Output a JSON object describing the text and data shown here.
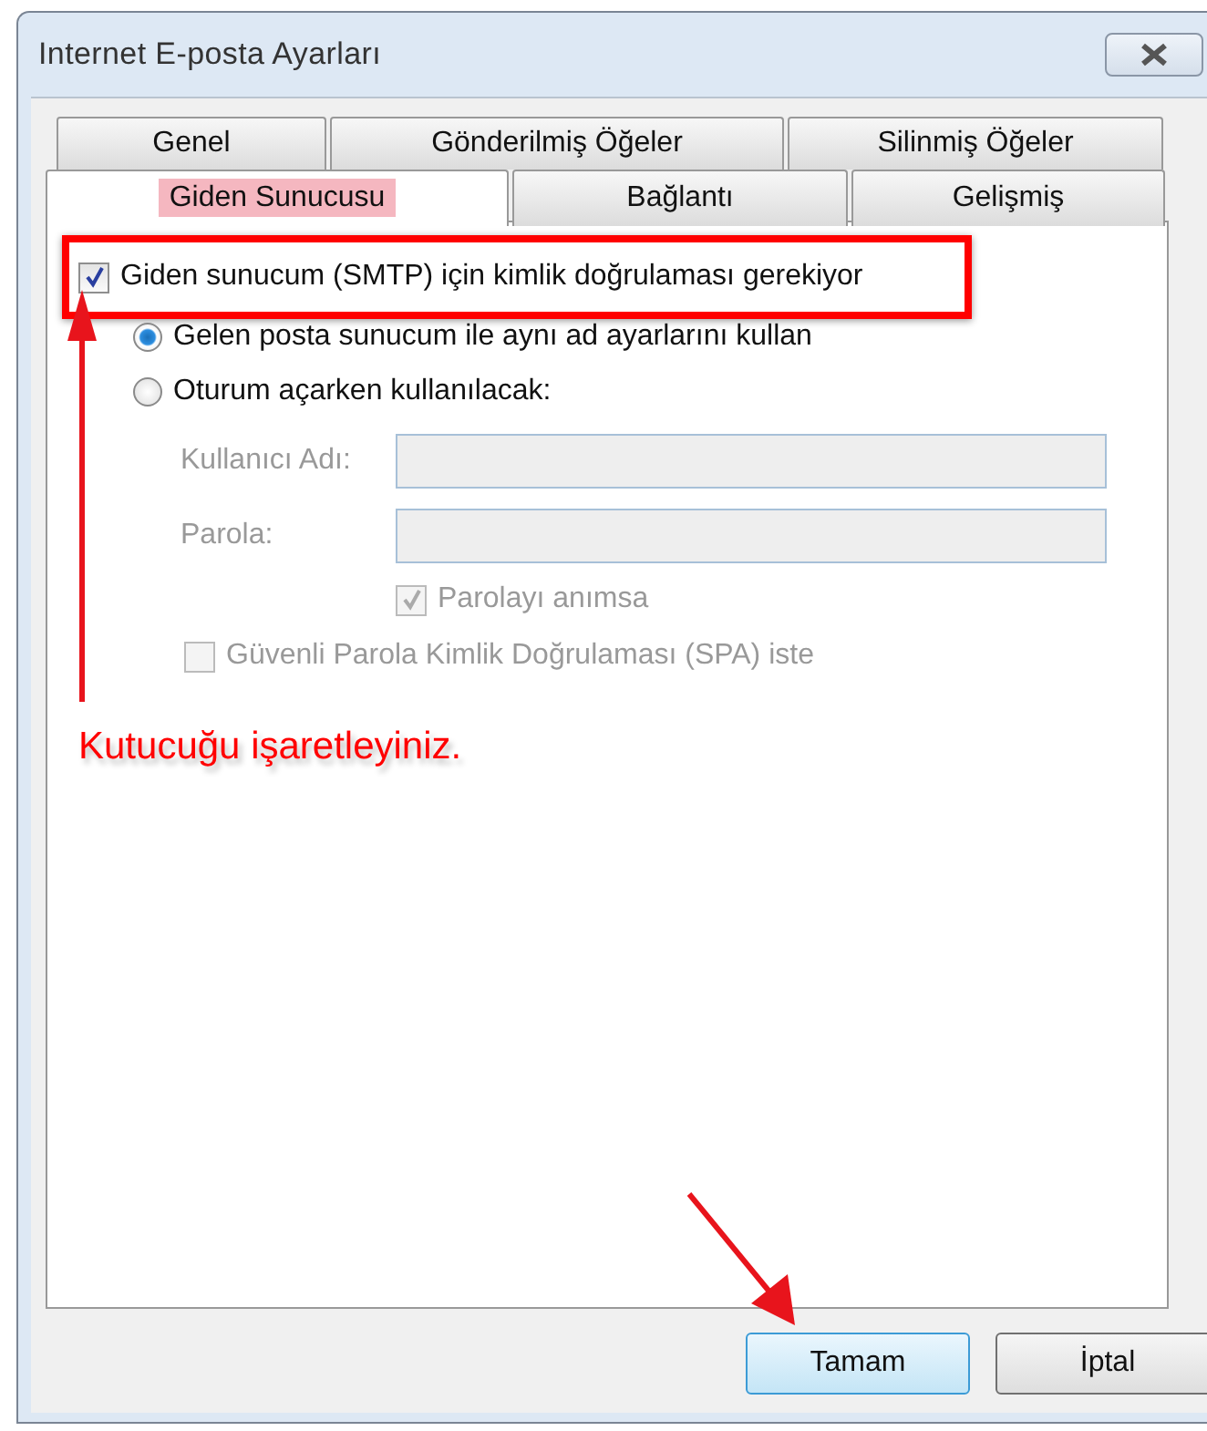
{
  "window": {
    "title": "Internet E-posta Ayarları"
  },
  "tab_rows": [
    [
      {
        "label": "Genel",
        "selected": false,
        "highlighted": false
      },
      {
        "label": "Gönderilmiş Öğeler",
        "selected": false,
        "highlighted": false
      },
      {
        "label": "Silinmiş Öğeler",
        "selected": false,
        "highlighted": false
      }
    ],
    [
      {
        "label": "Giden Sunucusu",
        "selected": true,
        "highlighted": true
      },
      {
        "label": "Bağlantı",
        "selected": false,
        "highlighted": false
      },
      {
        "label": "Gelişmiş",
        "selected": false,
        "highlighted": false
      }
    ]
  ],
  "auth_checkbox": {
    "label": "Giden sunucum (SMTP) için kimlik doğrulaması gerekiyor",
    "checked": true,
    "highlighted": true
  },
  "radios": [
    {
      "label": "Gelen posta sunucum ile aynı ad ayarlarını kullan",
      "selected": true
    },
    {
      "label": "Oturum açarken kullanılacak:",
      "selected": false
    }
  ],
  "fields": [
    {
      "label": "Kullanıcı Adı:",
      "disabled": true
    },
    {
      "label": "Parola:",
      "disabled": true
    }
  ],
  "remember_checkbox": {
    "label": "Parolayı anımsa",
    "checked": true,
    "disabled": true
  },
  "spa_checkbox": {
    "label": "Güvenli Parola Kimlik Doğrulaması (SPA) iste",
    "checked": false,
    "disabled": true
  },
  "annotation": {
    "text": "Kutucuğu işaretleyiniz."
  },
  "buttons": [
    {
      "label": "Tamam",
      "default": true
    },
    {
      "label": "İptal",
      "default": false
    }
  ]
}
